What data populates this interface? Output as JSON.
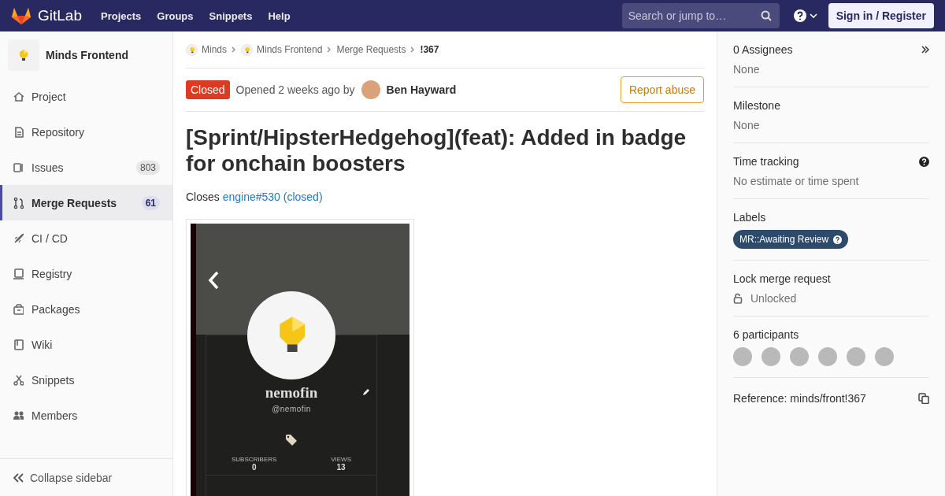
{
  "navbar": {
    "brand": "GitLab",
    "links": [
      "Projects",
      "Groups",
      "Snippets",
      "Help"
    ],
    "search": {
      "placeholder": "Search or jump to…"
    },
    "sign_in": "Sign in / Register"
  },
  "sidebar": {
    "project": "Minds Frontend",
    "items": [
      {
        "label": "Project",
        "selected": false
      },
      {
        "label": "Repository",
        "selected": false
      },
      {
        "label": "Issues",
        "count": "803",
        "selected": false
      },
      {
        "label": "Merge Requests",
        "count": "61",
        "selected": true
      },
      {
        "label": "CI / CD",
        "selected": false
      },
      {
        "label": "Registry",
        "selected": false
      },
      {
        "label": "Packages",
        "selected": false
      },
      {
        "label": "Wiki",
        "selected": false
      },
      {
        "label": "Snippets",
        "selected": false
      },
      {
        "label": "Members",
        "selected": false
      }
    ],
    "collapse": "Collapse sidebar"
  },
  "breadcrumbs": [
    {
      "label": "Minds",
      "avatar": true
    },
    {
      "label": "Minds Frontend",
      "avatar": true
    },
    {
      "label": "Merge Requests",
      "avatar": false
    },
    {
      "label": "!367",
      "avatar": false
    }
  ],
  "header": {
    "status": "Closed",
    "opened": "Opened 2 weeks ago by",
    "author": "Ben Hayward",
    "report": "Report abuse"
  },
  "title": "[Sprint/HipsterHedgehog](feat): Added in badge for onchain boosters",
  "description": {
    "text": "Closes",
    "link": "engine#530 (closed)"
  },
  "embedded_screenshot": {
    "name": "nemofin",
    "handle": "@nemofin",
    "stats": [
      {
        "label": "SUBSCRIBERS",
        "value": "0"
      },
      {
        "label": "VIEWS",
        "value": "13"
      }
    ]
  },
  "right_sidebar": {
    "assignees": {
      "title": "0 Assignees",
      "value": "None"
    },
    "milestone": {
      "title": "Milestone",
      "value": "None"
    },
    "time_tracking": {
      "title": "Time tracking",
      "value": "No estimate or time spent"
    },
    "labels": {
      "title": "Labels",
      "items": [
        {
          "text": "MR::Awaiting Review",
          "color": "#2e4a6b"
        }
      ]
    },
    "lock": {
      "title": "Lock merge request",
      "value": "Unlocked"
    },
    "participants": {
      "title": "6 participants",
      "avatars": [
        {
          "kind": "photo"
        },
        {
          "kind": "photo"
        },
        {
          "kind": "photo"
        },
        {
          "kind": "photo"
        },
        {
          "kind": "photo"
        },
        {
          "kind": "photo"
        }
      ]
    },
    "reference": "Reference: minds/front!367"
  }
}
